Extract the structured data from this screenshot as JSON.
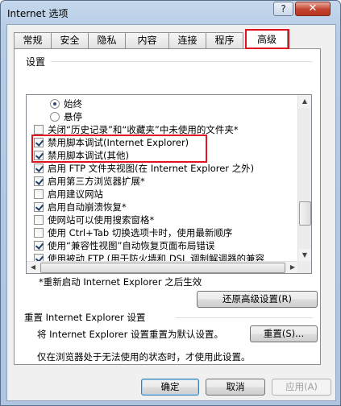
{
  "window": {
    "title": "Internet 选项"
  },
  "title_buttons": {
    "help": "?",
    "close": "✕"
  },
  "tabs": [
    {
      "label": "常规"
    },
    {
      "label": "安全"
    },
    {
      "label": "隐私"
    },
    {
      "label": "内容"
    },
    {
      "label": "连接"
    },
    {
      "label": "程序"
    },
    {
      "label": "高级",
      "active": true
    }
  ],
  "settings": {
    "group_label": "设置",
    "items": [
      {
        "type": "radio",
        "label": "始终",
        "state": "selected"
      },
      {
        "type": "radio",
        "label": "悬停",
        "state": "unselected"
      },
      {
        "type": "checkbox",
        "label": "关闭“历史记录”和“收藏夹”中未使用的文件夹*",
        "state": "unchecked"
      },
      {
        "type": "checkbox",
        "label": "禁用脚本调试(Internet Explorer)",
        "state": "checked"
      },
      {
        "type": "checkbox",
        "label": "禁用脚本调试(其他)",
        "state": "checked"
      },
      {
        "type": "checkbox",
        "label": "启用 FTP 文件夹视图(在 Internet Explorer 之外)",
        "state": "checked"
      },
      {
        "type": "checkbox",
        "label": "启用第三方浏览器扩展*",
        "state": "checked"
      },
      {
        "type": "checkbox",
        "label": "启用建议网站",
        "state": "unchecked"
      },
      {
        "type": "checkbox",
        "label": "启用自动崩溃恢复*",
        "state": "checked"
      },
      {
        "type": "checkbox",
        "label": "使网站可以使用搜索窗格*",
        "state": "unchecked"
      },
      {
        "type": "checkbox",
        "label": "使用 Ctrl+Tab 切换选项卡时，使用最新顺序",
        "state": "unchecked"
      },
      {
        "type": "checkbox",
        "label": "使用“兼容性视图”自动恢复页面布局错误",
        "state": "checked"
      },
      {
        "type": "checkbox",
        "label": "使用被动 FTP (用于防火墙和 DSL 调制解调器的兼容",
        "state": "checked"
      }
    ]
  },
  "restart_note": "*重新启动 Internet Explorer 之后生效",
  "restore_button": "还原高级设置(R)",
  "reset_section": {
    "heading": "重置 Internet Explorer 设置",
    "description": "将 Internet Explorer 设置重置为默认设置。",
    "reset_button": "重置(S)...",
    "note": "仅在浏览器处于无法使用的状态时，才使用此设置。"
  },
  "footer": {
    "ok": "确定",
    "cancel": "取消",
    "apply": "应用(A)"
  }
}
